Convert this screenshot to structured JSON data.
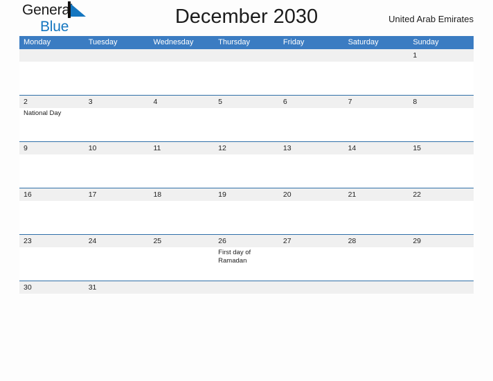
{
  "brand": {
    "word1": "General",
    "word2": "Blue",
    "triangle_color": "#1476c0",
    "bar_color": "#111111",
    "word2_color": "#1476c0"
  },
  "header": {
    "title": "December 2030",
    "region": "United Arab Emirates"
  },
  "theme": {
    "header_blue": "#3b7cc2",
    "rule_blue": "#2f6fa8",
    "band_gray": "#f0f0f0",
    "page_background": "#fdfdfd",
    "text_dark": "#1c1c1c",
    "weekday_text": "#ffffff"
  },
  "calendar": {
    "weekdays": [
      "Monday",
      "Tuesday",
      "Wednesday",
      "Thursday",
      "Friday",
      "Saturday",
      "Sunday"
    ],
    "weeks": [
      {
        "days": [
          {
            "number": "",
            "events": []
          },
          {
            "number": "",
            "events": []
          },
          {
            "number": "",
            "events": []
          },
          {
            "number": "",
            "events": []
          },
          {
            "number": "",
            "events": []
          },
          {
            "number": "",
            "events": []
          },
          {
            "number": "1",
            "events": []
          }
        ]
      },
      {
        "days": [
          {
            "number": "2",
            "events": [
              "National Day"
            ]
          },
          {
            "number": "3",
            "events": []
          },
          {
            "number": "4",
            "events": []
          },
          {
            "number": "5",
            "events": []
          },
          {
            "number": "6",
            "events": []
          },
          {
            "number": "7",
            "events": []
          },
          {
            "number": "8",
            "events": []
          }
        ]
      },
      {
        "days": [
          {
            "number": "9",
            "events": []
          },
          {
            "number": "10",
            "events": []
          },
          {
            "number": "11",
            "events": []
          },
          {
            "number": "12",
            "events": []
          },
          {
            "number": "13",
            "events": []
          },
          {
            "number": "14",
            "events": []
          },
          {
            "number": "15",
            "events": []
          }
        ]
      },
      {
        "days": [
          {
            "number": "16",
            "events": []
          },
          {
            "number": "17",
            "events": []
          },
          {
            "number": "18",
            "events": []
          },
          {
            "number": "19",
            "events": []
          },
          {
            "number": "20",
            "events": []
          },
          {
            "number": "21",
            "events": []
          },
          {
            "number": "22",
            "events": []
          }
        ]
      },
      {
        "days": [
          {
            "number": "23",
            "events": []
          },
          {
            "number": "24",
            "events": []
          },
          {
            "number": "25",
            "events": []
          },
          {
            "number": "26",
            "events": [
              "First day of Ramadan"
            ]
          },
          {
            "number": "27",
            "events": []
          },
          {
            "number": "28",
            "events": []
          },
          {
            "number": "29",
            "events": []
          }
        ]
      },
      {
        "days": [
          {
            "number": "30",
            "events": []
          },
          {
            "number": "31",
            "events": []
          },
          {
            "number": "",
            "events": []
          },
          {
            "number": "",
            "events": []
          },
          {
            "number": "",
            "events": []
          },
          {
            "number": "",
            "events": []
          },
          {
            "number": "",
            "events": []
          }
        ]
      }
    ]
  }
}
